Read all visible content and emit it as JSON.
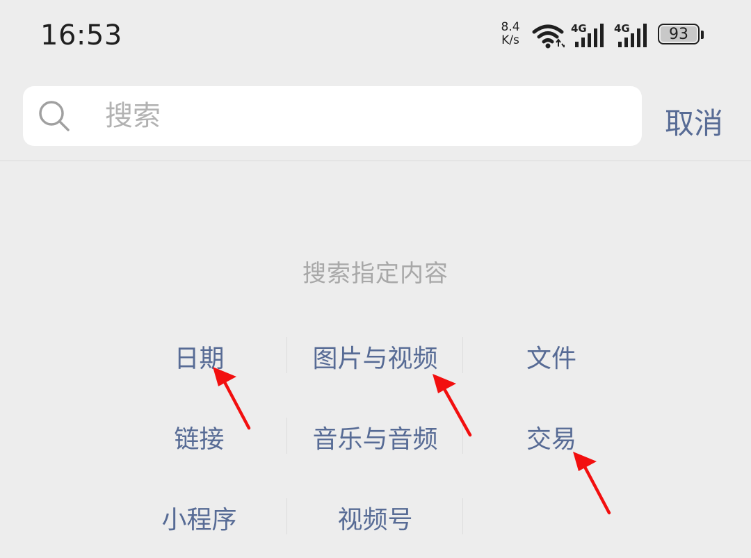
{
  "status_bar": {
    "time": "16:53",
    "net_speed_value": "8.4",
    "net_speed_unit": "K/s",
    "signal1_label": "4G",
    "signal2_label": "4G",
    "battery": "93",
    "icons": [
      "wifi-icon",
      "signal-icon",
      "signal-icon",
      "battery-icon"
    ]
  },
  "search": {
    "placeholder": "搜索",
    "value": "",
    "cancel_label": "取消"
  },
  "section": {
    "title": "搜索指定内容",
    "categories": [
      {
        "label": "日期"
      },
      {
        "label": "图片与视频"
      },
      {
        "label": "文件"
      },
      {
        "label": "链接"
      },
      {
        "label": "音乐与音频"
      },
      {
        "label": "交易"
      },
      {
        "label": "小程序"
      },
      {
        "label": "视频号"
      },
      {
        "label": ""
      }
    ]
  },
  "colors": {
    "background": "#ededed",
    "link_blue": "#576b95",
    "hint_gray": "#a8a8a8",
    "annotation_red": "#f20f0f"
  }
}
